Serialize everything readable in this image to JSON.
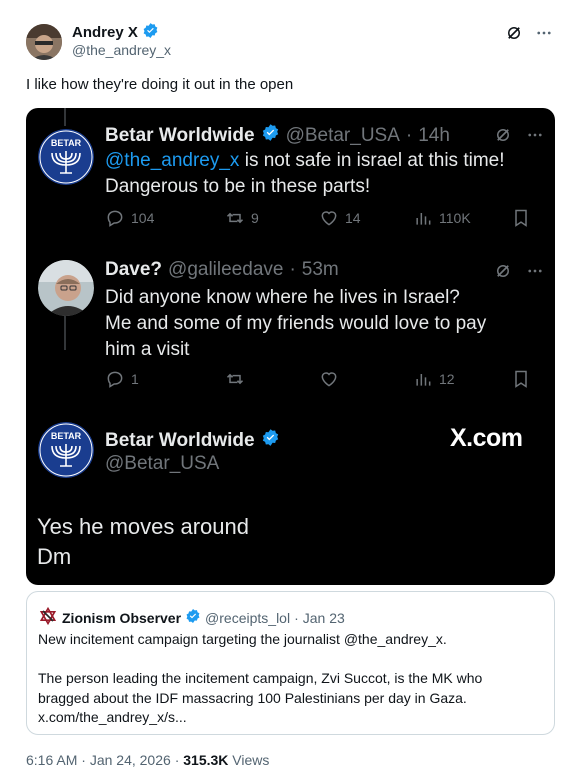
{
  "author": {
    "name": "Andrey X",
    "handle": "@the_andrey_x"
  },
  "tweet_text": "I like how they're doing it out in the open",
  "embedded": {
    "post1": {
      "name": "Betar Worldwide",
      "handle": "@Betar_USA",
      "time": "14h",
      "body_mention": "@the_andrey_x",
      "body_line1": " is not safe in israel at this time!",
      "body_line2": "Dangerous to be in these parts!",
      "replies": "104",
      "reposts": "9",
      "likes": "14",
      "views": "110K",
      "avatar_text": "BETAR"
    },
    "post2": {
      "name": "Dave?",
      "handle": "@galileedave",
      "time": "53m",
      "body_line1": "Did anyone know where he lives in Israel?",
      "body_line2": "Me and some of my friends would love to pay",
      "body_line3": "him a visit",
      "replies": "1",
      "views": "12"
    },
    "post3": {
      "name": "Betar Worldwide",
      "handle": "@Betar_USA",
      "body_line1": "Yes he moves around",
      "body_line2": "Dm",
      "avatar_text": "BETAR"
    },
    "site_label": "X.com"
  },
  "quote": {
    "name": "Zionism Observer",
    "handle": "@receipts_lol",
    "date": "Jan 23",
    "line1": "New incitement campaign targeting the journalist @the_andrey_x.",
    "line2": "The person leading the incitement campaign, Zvi Succot, is the MK who",
    "line3": "bragged about the IDF massacring 100 Palestinians per day in Gaza.",
    "line4": "x.com/the_andrey_x/s..."
  },
  "footer": {
    "time": "6:16 AM",
    "date": "Jan 24, 2026",
    "views_count": "315.3K",
    "views_label": "Views"
  },
  "colors": {
    "accent": "#1d9bf0",
    "media_bg": "#000000",
    "muted": "#536471"
  }
}
